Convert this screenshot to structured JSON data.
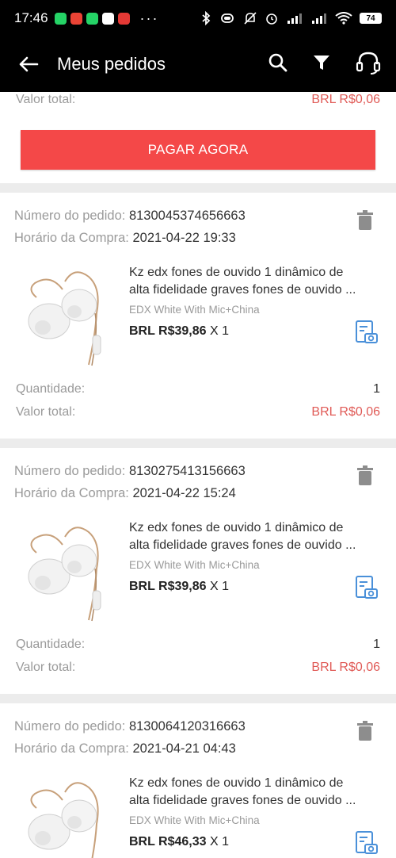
{
  "status": {
    "time": "17:46",
    "dots": "···",
    "battery": "74",
    "app_colors": [
      "#25d366",
      "#ea4335",
      "#25d366",
      "#ffffff",
      "#e53935"
    ]
  },
  "header": {
    "title": "Meus pedidos",
    "icons": [
      "back-arrow-icon",
      "search-icon",
      "filter-icon",
      "headset-icon"
    ]
  },
  "top_partial": {
    "total_label": "Valor total:",
    "total_value": "BRL R$0,06",
    "pay_button": "PAGAR AGORA"
  },
  "orders": [
    {
      "number_label": "Número do pedido:",
      "number": "8130045374656663",
      "time_label": "Horário da Compra:",
      "time": "2021-04-22 19:33",
      "title_line1": "Kz edx fones de ouvido 1 dinâmico de",
      "title_line2": "alta fidelidade graves fones de ouvido ...",
      "variant": "EDX White With Mic+China",
      "price": "BRL R$39,86",
      "qty": "X 1",
      "quantity_label": "Quantidade:",
      "quantity": "1",
      "total_label": "Valor total:",
      "total": "BRL R$0,06"
    },
    {
      "number_label": "Número do pedido:",
      "number": "8130275413156663",
      "time_label": "Horário da Compra:",
      "time": "2021-04-22 15:24",
      "title_line1": "Kz edx fones de ouvido 1 dinâmico de",
      "title_line2": "alta fidelidade graves fones de ouvido ...",
      "variant": "EDX White With Mic+China",
      "price": "BRL R$39,86",
      "qty": "X 1",
      "quantity_label": "Quantidade:",
      "quantity": "1",
      "total_label": "Valor total:",
      "total": "BRL R$0,06"
    },
    {
      "number_label": "Número do pedido:",
      "number": "8130064120316663",
      "time_label": "Horário da Compra:",
      "time": "2021-04-21 04:43",
      "title_line1": "Kz edx fones de ouvido 1 dinâmico de",
      "title_line2": "alta fidelidade graves fones de ouvido ...",
      "variant": "EDX White With Mic+China",
      "price": "BRL R$46,33",
      "qty": "X 1"
    }
  ],
  "colors": {
    "accent_red": "#f44848",
    "price_red": "#e05a56",
    "review_blue": "#4a90d9"
  }
}
